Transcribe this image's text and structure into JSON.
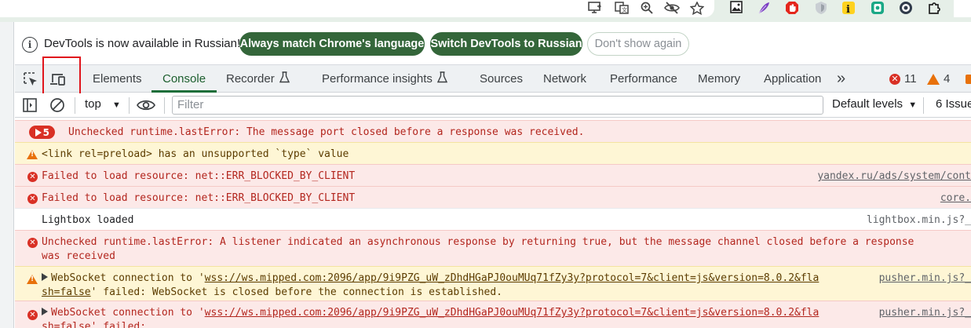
{
  "colors": {
    "accent": "#34663a",
    "error_bg": "#fce9e8",
    "warning_bg": "#fef6d5",
    "error": "#d93025",
    "warning": "#e8710a",
    "highlight": "#e0151c"
  },
  "browser_toolbar": {
    "icons": [
      "cast-icon",
      "translate-icon",
      "zoom-icon",
      "eye-off-icon",
      "star-icon"
    ],
    "extensions": [
      "image-extension-icon",
      "feather-extension-icon",
      "adblock-extension-icon",
      "shield-extension-icon",
      "yellow-i-extension-icon",
      "green-extension-icon",
      "blue-extension-icon",
      "puzzle-extension-icon"
    ]
  },
  "infobar": {
    "message": "DevTools is now available in Russian!",
    "always_match_label": "Always match Chrome's language",
    "switch_label": "Switch DevTools to Russian",
    "dont_show_label": "Don't show again"
  },
  "tabs": [
    {
      "label": "Elements"
    },
    {
      "label": "Console",
      "active": true
    },
    {
      "label": "Recorder"
    },
    {
      "label": "Performance insights"
    },
    {
      "label": "Sources"
    },
    {
      "label": "Network"
    },
    {
      "label": "Performance"
    },
    {
      "label": "Memory"
    },
    {
      "label": "Application"
    }
  ],
  "tab_more": "»",
  "counts": {
    "errors": "11",
    "warnings": "4"
  },
  "console_toolbar": {
    "context": "top",
    "filter_placeholder": "Filter",
    "levels": "Default levels",
    "issues": "6 Issue"
  },
  "messages": [
    {
      "type": "error",
      "repeat": "5",
      "text": "Unchecked runtime.lastError: The message port closed before a response was received.",
      "source": ""
    },
    {
      "type": "warning",
      "text": "<link rel=preload> has an unsupported `type` value",
      "source": ""
    },
    {
      "type": "error",
      "text": "Failed to load resource: net::ERR_BLOCKED_BY_CLIENT",
      "source": "yandex.ru/ads/system/cont"
    },
    {
      "type": "error",
      "text": "Failed to load resource: net::ERR_BLOCKED_BY_CLIENT",
      "source": "core."
    },
    {
      "type": "info",
      "text": "Lightbox loaded",
      "source": "lightbox.min.js?_"
    },
    {
      "type": "error",
      "text": "Unchecked runtime.lastError: A listener indicated an asynchronous response by returning true, but the message channel closed before a response",
      "text2": "was received",
      "source": ""
    },
    {
      "type": "warning",
      "prefix": "WebSocket connection to '",
      "url": "wss://ws.mipped.com:2096/app/9i9PZG_uW_zDhdHGaPJ0ouMUq71fZy3y?protocol=7&client=js&version=8.0.2&fla",
      "text2_link": "sh=false",
      "text2_rest": "' failed: WebSocket is closed before the connection is established.",
      "source": "pusher.min.js?_"
    },
    {
      "type": "error",
      "prefix": "WebSocket connection to '",
      "url": "wss://ws.mipped.com:2096/app/9i9PZG_uW_zDhdHGaPJ0ouMUq71fZy3y?protocol=7&client=js&version=8.0.2&fla",
      "text2_link": "sh=false",
      "text2_rest": "' failed:",
      "source": "pusher.min.js?_"
    }
  ]
}
